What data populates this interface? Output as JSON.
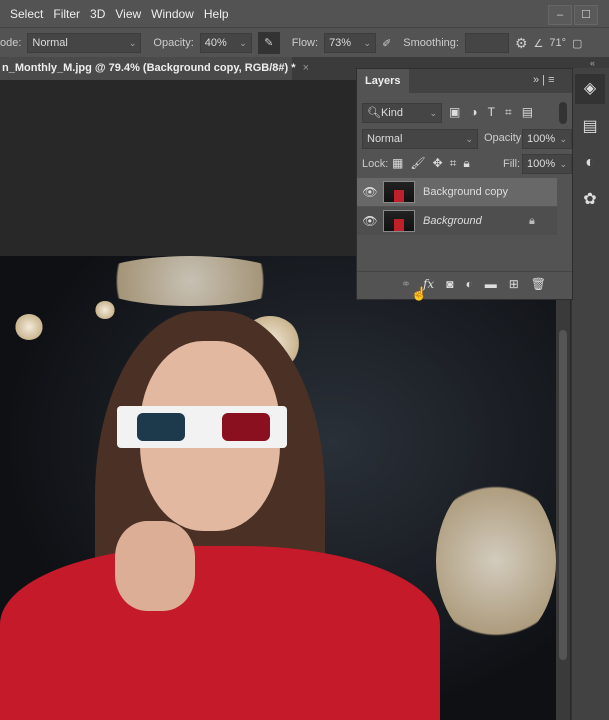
{
  "menu": [
    "Select",
    "Filter",
    "3D",
    "View",
    "Window",
    "Help"
  ],
  "options": {
    "mode_label": "ode:",
    "mode_value": "Normal",
    "opacity_label": "Opacity:",
    "opacity_value": "40%",
    "flow_label": "Flow:",
    "flow_value": "73%",
    "smoothing_label": "Smoothing:",
    "angle_value": "71°"
  },
  "document_tab": {
    "title": "n_Monthly_M.jpg @ 79.4% (Background copy, RGB/8#) *",
    "close": "×"
  },
  "layers_panel": {
    "title": "Layers",
    "filter_kind": "Kind",
    "blend_mode": "Normal",
    "opacity_label": "Opacity:",
    "opacity_value": "100%",
    "lock_label": "Lock:",
    "fill_label": "Fill:",
    "fill_value": "100%",
    "layers": [
      {
        "name": "Background copy",
        "selected": true
      },
      {
        "name": "Background",
        "locked": true
      }
    ],
    "footer_fx": "fx"
  }
}
